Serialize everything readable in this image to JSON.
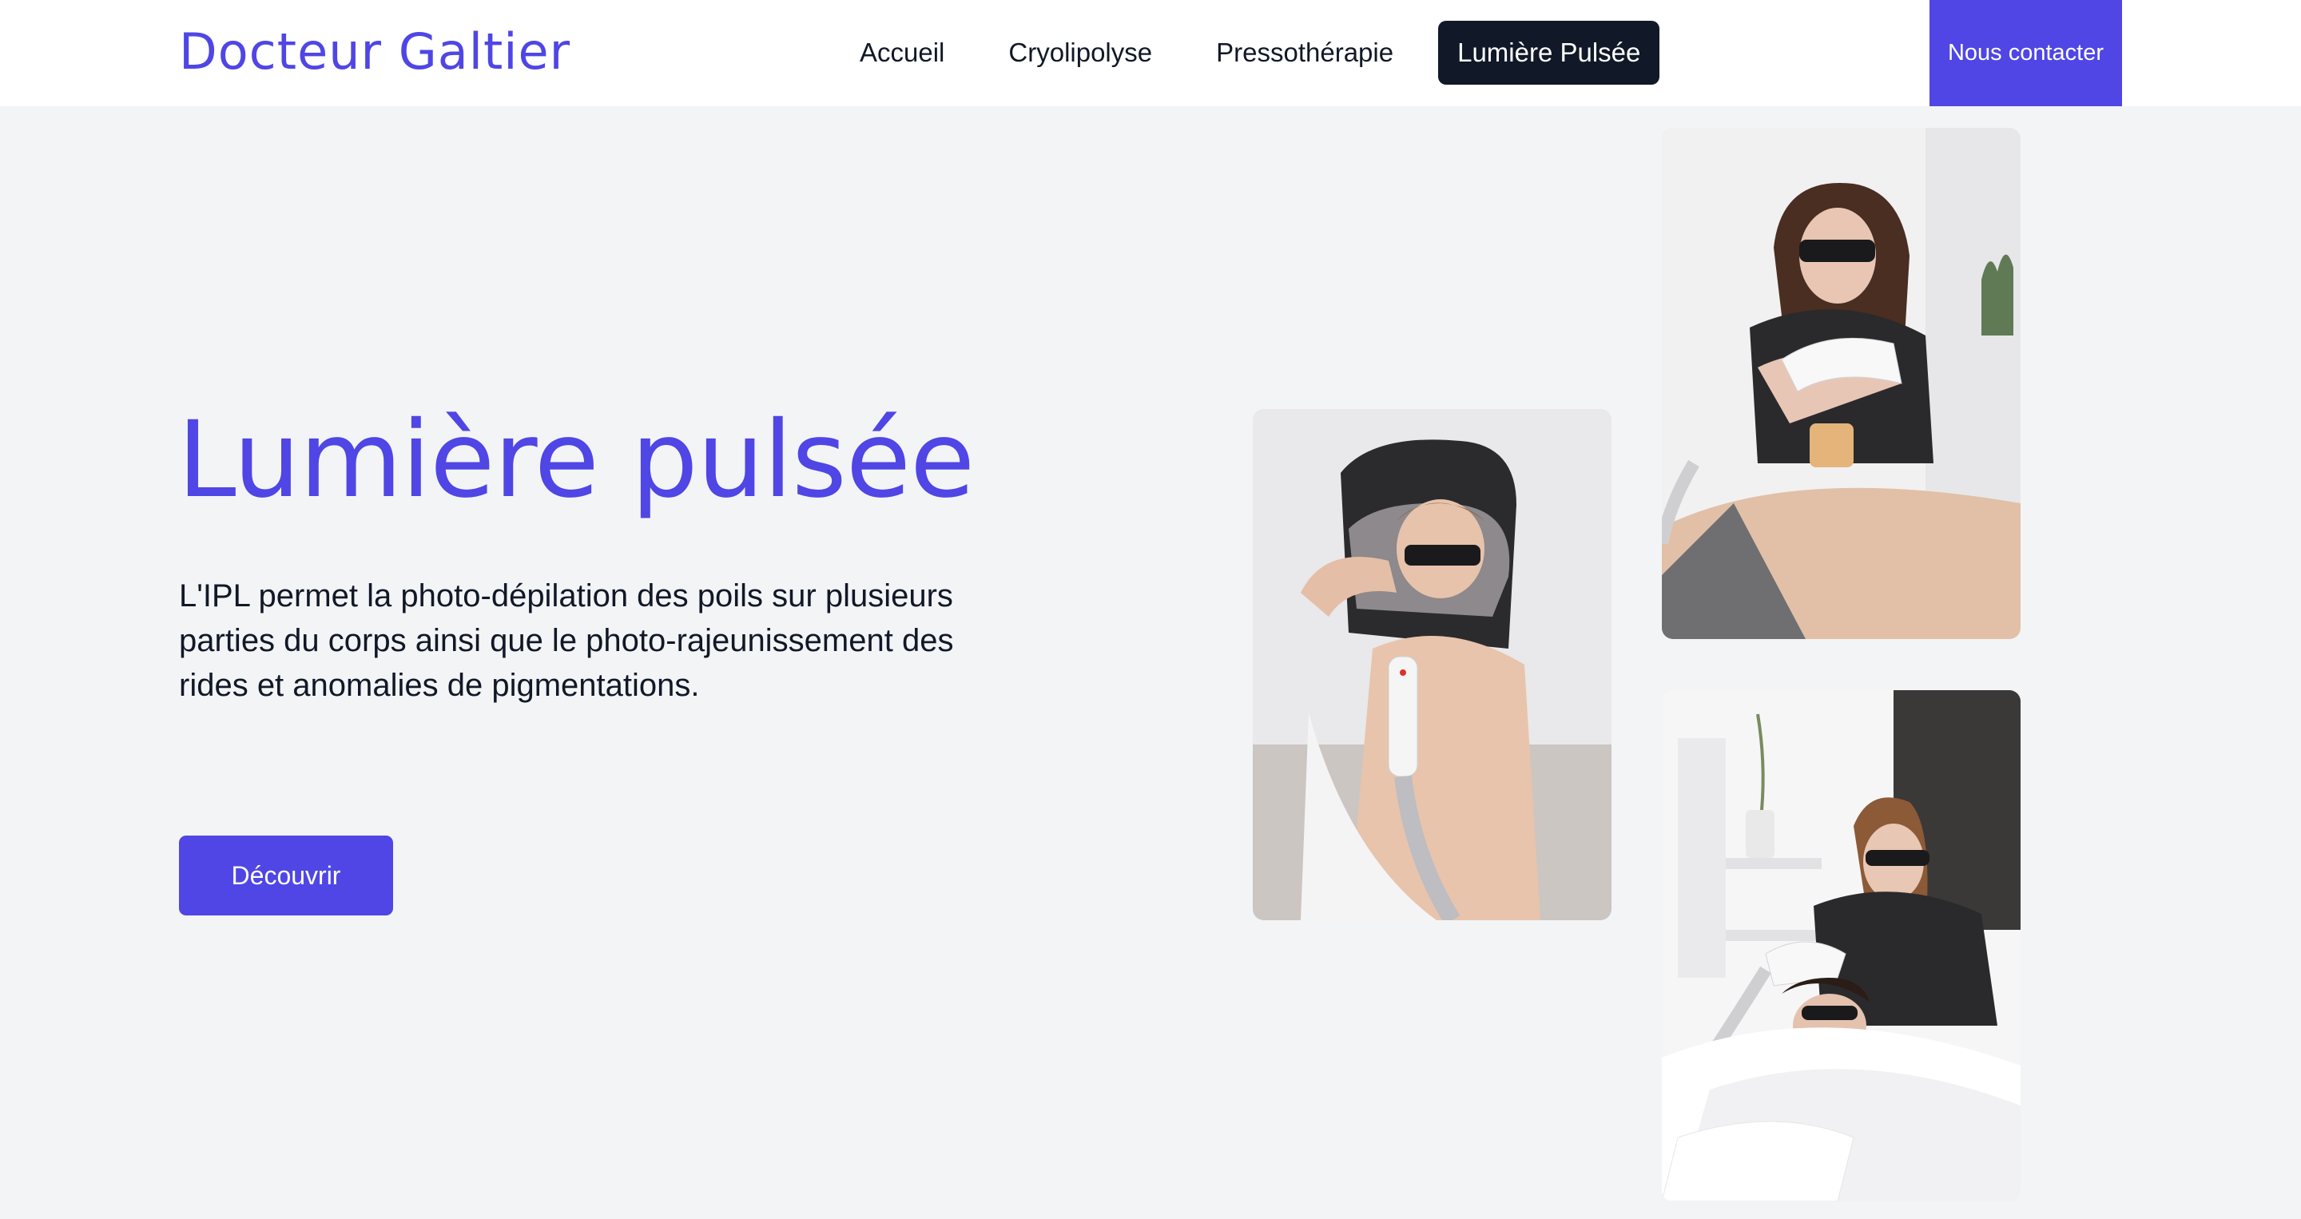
{
  "header": {
    "logo": "Docteur Galtier",
    "nav": [
      {
        "label": "Accueil",
        "active": false
      },
      {
        "label": "Cryolipolyse",
        "active": false
      },
      {
        "label": "Pressothérapie",
        "active": false
      },
      {
        "label": "Lumière Pulsée",
        "active": true
      }
    ],
    "contact_label": "Nous contacter"
  },
  "hero": {
    "title": "Lumière pulsée",
    "description": "L'IPL permet la photo-dépilation des poils sur plusieurs parties du corps ainsi que le photo-rajeunissement des rides et anomalies de pigmentations.",
    "cta_label": "Découvrir"
  },
  "colors": {
    "accent": "#4f46e5",
    "dark": "#111827",
    "background": "#f3f4f6"
  }
}
